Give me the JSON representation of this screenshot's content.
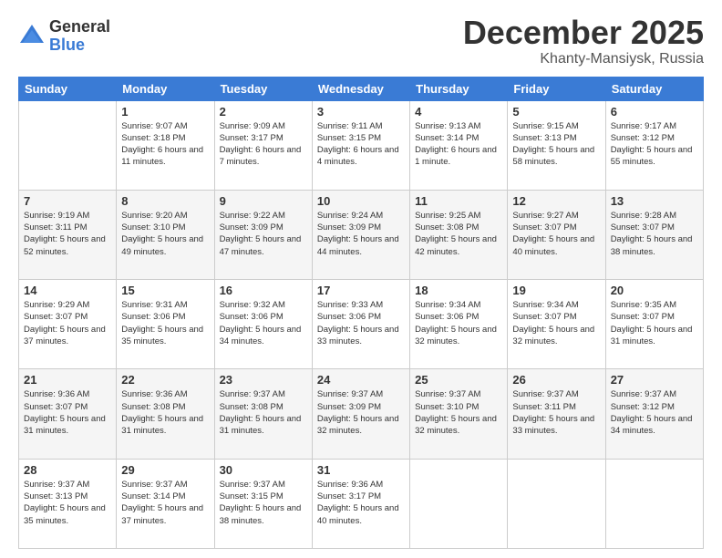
{
  "logo": {
    "general": "General",
    "blue": "Blue"
  },
  "title": "December 2025",
  "location": "Khanty-Mansiysk, Russia",
  "weekdays": [
    "Sunday",
    "Monday",
    "Tuesday",
    "Wednesday",
    "Thursday",
    "Friday",
    "Saturday"
  ],
  "weeks": [
    [
      {
        "day": "",
        "sunrise": "",
        "sunset": "",
        "daylight": ""
      },
      {
        "day": "1",
        "sunrise": "Sunrise: 9:07 AM",
        "sunset": "Sunset: 3:18 PM",
        "daylight": "Daylight: 6 hours and 11 minutes."
      },
      {
        "day": "2",
        "sunrise": "Sunrise: 9:09 AM",
        "sunset": "Sunset: 3:17 PM",
        "daylight": "Daylight: 6 hours and 7 minutes."
      },
      {
        "day": "3",
        "sunrise": "Sunrise: 9:11 AM",
        "sunset": "Sunset: 3:15 PM",
        "daylight": "Daylight: 6 hours and 4 minutes."
      },
      {
        "day": "4",
        "sunrise": "Sunrise: 9:13 AM",
        "sunset": "Sunset: 3:14 PM",
        "daylight": "Daylight: 6 hours and 1 minute."
      },
      {
        "day": "5",
        "sunrise": "Sunrise: 9:15 AM",
        "sunset": "Sunset: 3:13 PM",
        "daylight": "Daylight: 5 hours and 58 minutes."
      },
      {
        "day": "6",
        "sunrise": "Sunrise: 9:17 AM",
        "sunset": "Sunset: 3:12 PM",
        "daylight": "Daylight: 5 hours and 55 minutes."
      }
    ],
    [
      {
        "day": "7",
        "sunrise": "Sunrise: 9:19 AM",
        "sunset": "Sunset: 3:11 PM",
        "daylight": "Daylight: 5 hours and 52 minutes."
      },
      {
        "day": "8",
        "sunrise": "Sunrise: 9:20 AM",
        "sunset": "Sunset: 3:10 PM",
        "daylight": "Daylight: 5 hours and 49 minutes."
      },
      {
        "day": "9",
        "sunrise": "Sunrise: 9:22 AM",
        "sunset": "Sunset: 3:09 PM",
        "daylight": "Daylight: 5 hours and 47 minutes."
      },
      {
        "day": "10",
        "sunrise": "Sunrise: 9:24 AM",
        "sunset": "Sunset: 3:09 PM",
        "daylight": "Daylight: 5 hours and 44 minutes."
      },
      {
        "day": "11",
        "sunrise": "Sunrise: 9:25 AM",
        "sunset": "Sunset: 3:08 PM",
        "daylight": "Daylight: 5 hours and 42 minutes."
      },
      {
        "day": "12",
        "sunrise": "Sunrise: 9:27 AM",
        "sunset": "Sunset: 3:07 PM",
        "daylight": "Daylight: 5 hours and 40 minutes."
      },
      {
        "day": "13",
        "sunrise": "Sunrise: 9:28 AM",
        "sunset": "Sunset: 3:07 PM",
        "daylight": "Daylight: 5 hours and 38 minutes."
      }
    ],
    [
      {
        "day": "14",
        "sunrise": "Sunrise: 9:29 AM",
        "sunset": "Sunset: 3:07 PM",
        "daylight": "Daylight: 5 hours and 37 minutes."
      },
      {
        "day": "15",
        "sunrise": "Sunrise: 9:31 AM",
        "sunset": "Sunset: 3:06 PM",
        "daylight": "Daylight: 5 hours and 35 minutes."
      },
      {
        "day": "16",
        "sunrise": "Sunrise: 9:32 AM",
        "sunset": "Sunset: 3:06 PM",
        "daylight": "Daylight: 5 hours and 34 minutes."
      },
      {
        "day": "17",
        "sunrise": "Sunrise: 9:33 AM",
        "sunset": "Sunset: 3:06 PM",
        "daylight": "Daylight: 5 hours and 33 minutes."
      },
      {
        "day": "18",
        "sunrise": "Sunrise: 9:34 AM",
        "sunset": "Sunset: 3:06 PM",
        "daylight": "Daylight: 5 hours and 32 minutes."
      },
      {
        "day": "19",
        "sunrise": "Sunrise: 9:34 AM",
        "sunset": "Sunset: 3:07 PM",
        "daylight": "Daylight: 5 hours and 32 minutes."
      },
      {
        "day": "20",
        "sunrise": "Sunrise: 9:35 AM",
        "sunset": "Sunset: 3:07 PM",
        "daylight": "Daylight: 5 hours and 31 minutes."
      }
    ],
    [
      {
        "day": "21",
        "sunrise": "Sunrise: 9:36 AM",
        "sunset": "Sunset: 3:07 PM",
        "daylight": "Daylight: 5 hours and 31 minutes."
      },
      {
        "day": "22",
        "sunrise": "Sunrise: 9:36 AM",
        "sunset": "Sunset: 3:08 PM",
        "daylight": "Daylight: 5 hours and 31 minutes."
      },
      {
        "day": "23",
        "sunrise": "Sunrise: 9:37 AM",
        "sunset": "Sunset: 3:08 PM",
        "daylight": "Daylight: 5 hours and 31 minutes."
      },
      {
        "day": "24",
        "sunrise": "Sunrise: 9:37 AM",
        "sunset": "Sunset: 3:09 PM",
        "daylight": "Daylight: 5 hours and 32 minutes."
      },
      {
        "day": "25",
        "sunrise": "Sunrise: 9:37 AM",
        "sunset": "Sunset: 3:10 PM",
        "daylight": "Daylight: 5 hours and 32 minutes."
      },
      {
        "day": "26",
        "sunrise": "Sunrise: 9:37 AM",
        "sunset": "Sunset: 3:11 PM",
        "daylight": "Daylight: 5 hours and 33 minutes."
      },
      {
        "day": "27",
        "sunrise": "Sunrise: 9:37 AM",
        "sunset": "Sunset: 3:12 PM",
        "daylight": "Daylight: 5 hours and 34 minutes."
      }
    ],
    [
      {
        "day": "28",
        "sunrise": "Sunrise: 9:37 AM",
        "sunset": "Sunset: 3:13 PM",
        "daylight": "Daylight: 5 hours and 35 minutes."
      },
      {
        "day": "29",
        "sunrise": "Sunrise: 9:37 AM",
        "sunset": "Sunset: 3:14 PM",
        "daylight": "Daylight: 5 hours and 37 minutes."
      },
      {
        "day": "30",
        "sunrise": "Sunrise: 9:37 AM",
        "sunset": "Sunset: 3:15 PM",
        "daylight": "Daylight: 5 hours and 38 minutes."
      },
      {
        "day": "31",
        "sunrise": "Sunrise: 9:36 AM",
        "sunset": "Sunset: 3:17 PM",
        "daylight": "Daylight: 5 hours and 40 minutes."
      },
      {
        "day": "",
        "sunrise": "",
        "sunset": "",
        "daylight": ""
      },
      {
        "day": "",
        "sunrise": "",
        "sunset": "",
        "daylight": ""
      },
      {
        "day": "",
        "sunrise": "",
        "sunset": "",
        "daylight": ""
      }
    ]
  ]
}
